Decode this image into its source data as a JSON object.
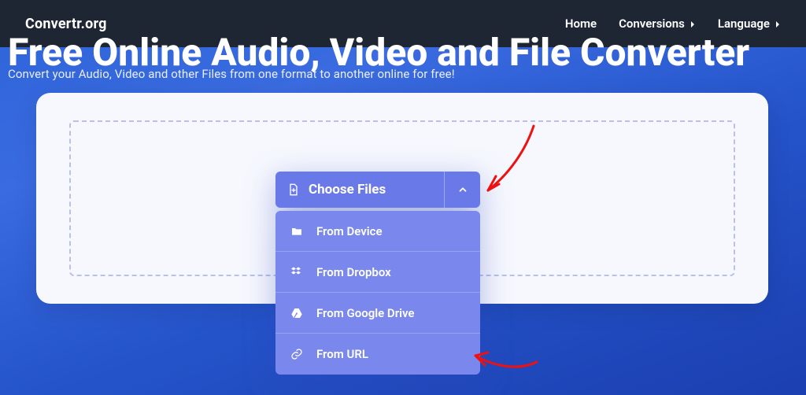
{
  "nav": {
    "brand": "Convertr.org",
    "home": "Home",
    "conversions": "Conversions",
    "language": "Language"
  },
  "hero": {
    "title_fragment": "Free Online Audio, Video and File Converter",
    "subtitle": "Convert your Audio, Video and other Files from one format to another online for free!"
  },
  "choose": {
    "label": "Choose Files"
  },
  "menu": {
    "device": "From Device",
    "dropbox": "From Dropbox",
    "gdrive": "From Google Drive",
    "url": "From URL"
  }
}
